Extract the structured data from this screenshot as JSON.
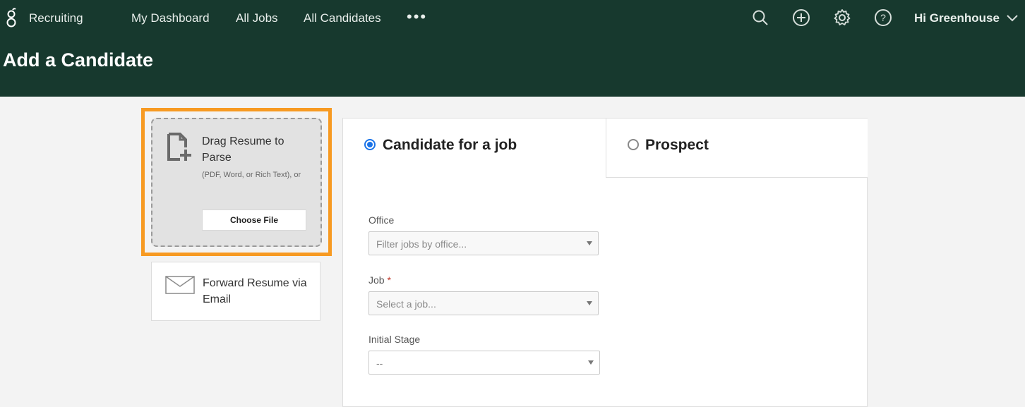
{
  "header": {
    "brand": "Recruiting",
    "nav": [
      "My Dashboard",
      "All Jobs",
      "All Candidates"
    ],
    "more": "•••",
    "icons": [
      "search-icon",
      "add-circle-icon",
      "gear-icon",
      "help-icon"
    ],
    "user": "Hi Greenhouse"
  },
  "page_title": "Add a Candidate",
  "upload": {
    "drag_title": "Drag Resume to Parse",
    "drag_sub": "(PDF, Word, or Rich Text), or",
    "choose_file": "Choose File",
    "forward": "Forward Resume via Email"
  },
  "form": {
    "tabs": [
      "Candidate for a job",
      "Prospect"
    ],
    "selected_tab": "Candidate for a job",
    "office": {
      "label": "Office",
      "placeholder": "Filter jobs by office..."
    },
    "job": {
      "label": "Job",
      "required": "*",
      "placeholder": "Select a job..."
    },
    "stage": {
      "label": "Initial Stage",
      "value": "--"
    }
  },
  "colors": {
    "header_bg": "#17392e",
    "highlight": "#f79a22",
    "radio_active": "#1a73e8"
  }
}
